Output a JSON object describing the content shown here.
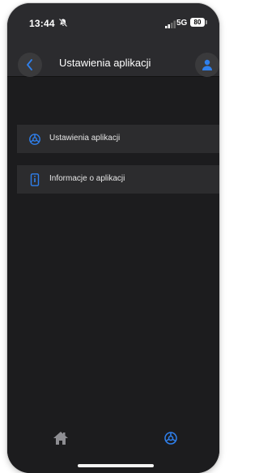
{
  "status_bar": {
    "time": "13:44",
    "network": "5G",
    "battery": "80"
  },
  "nav": {
    "title": "Ustawienia aplikacji"
  },
  "menu": {
    "items": [
      {
        "label": "Ustawienia aplikacji",
        "icon": "gear-icon"
      },
      {
        "label": "Informacje o aplikacji",
        "icon": "phone-info-icon"
      }
    ]
  },
  "tabbar": {
    "tabs": [
      {
        "icon": "home-icon"
      },
      {
        "icon": "gear-icon"
      }
    ]
  },
  "colors": {
    "background": "#1c1c1e",
    "accent": "#2f80ed",
    "text": "#ffffff"
  }
}
